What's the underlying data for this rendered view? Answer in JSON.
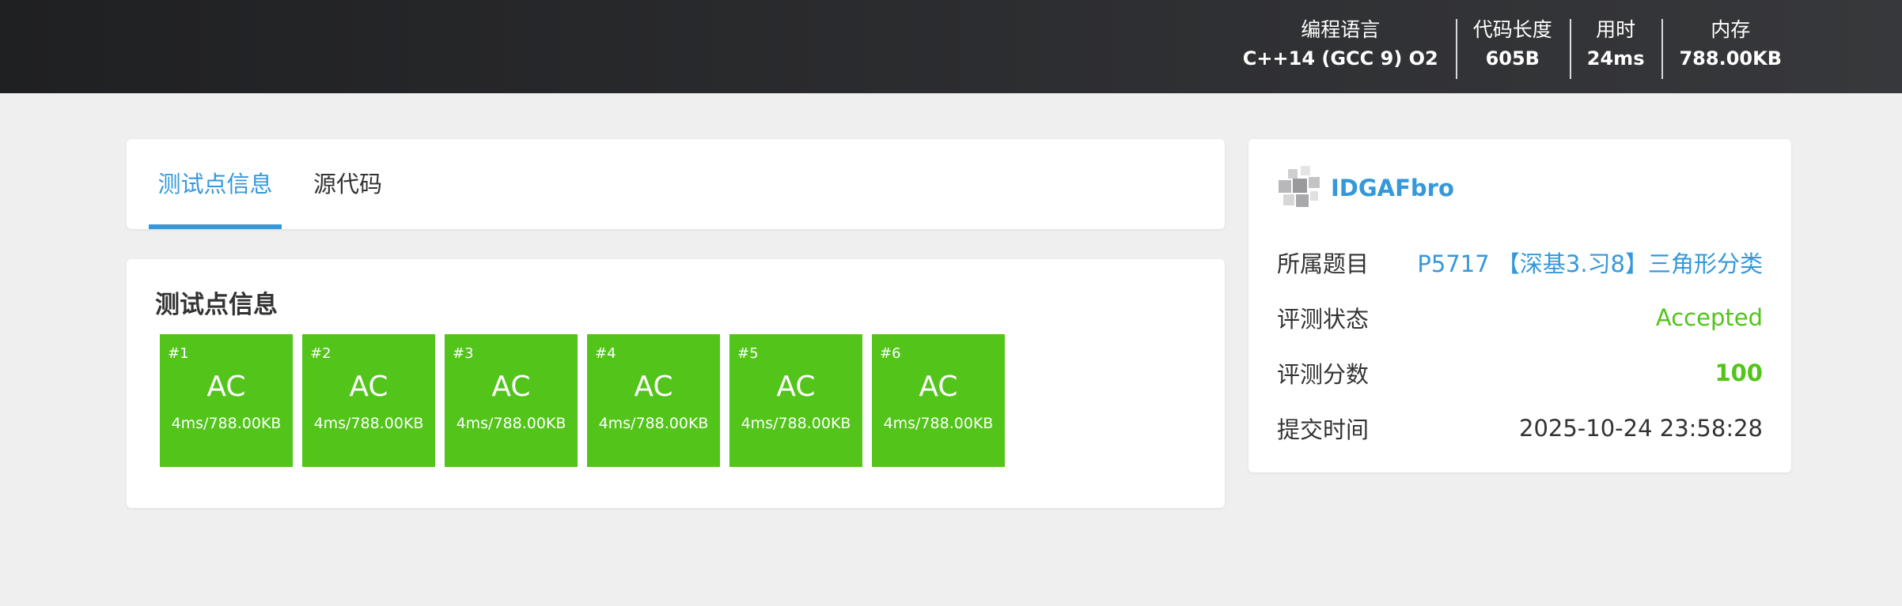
{
  "header": {
    "stats": [
      {
        "label": "编程语言",
        "value": "C++14 (GCC 9) O2"
      },
      {
        "label": "代码长度",
        "value": "605B"
      },
      {
        "label": "用时",
        "value": "24ms"
      },
      {
        "label": "内存",
        "value": "788.00KB"
      }
    ]
  },
  "tabs": {
    "testcases": "测试点信息",
    "source": "源代码"
  },
  "cases_title": "测试点信息",
  "cases": [
    {
      "id": "#1",
      "status": "AC",
      "info": "4ms/788.00KB"
    },
    {
      "id": "#2",
      "status": "AC",
      "info": "4ms/788.00KB"
    },
    {
      "id": "#3",
      "status": "AC",
      "info": "4ms/788.00KB"
    },
    {
      "id": "#4",
      "status": "AC",
      "info": "4ms/788.00KB"
    },
    {
      "id": "#5",
      "status": "AC",
      "info": "4ms/788.00KB"
    },
    {
      "id": "#6",
      "status": "AC",
      "info": "4ms/788.00KB"
    }
  ],
  "side": {
    "username": "IDGAFbro",
    "problem_label": "所属题目",
    "problem_value": "P5717 【深基3.习8】三角形分类",
    "status_label": "评测状态",
    "status_value": "Accepted",
    "score_label": "评测分数",
    "score_value": "100",
    "time_label": "提交时间",
    "time_value": "2025-10-24 23:58:28"
  },
  "colors": {
    "accent": "#3498db",
    "ac_green": "#52c41a"
  }
}
